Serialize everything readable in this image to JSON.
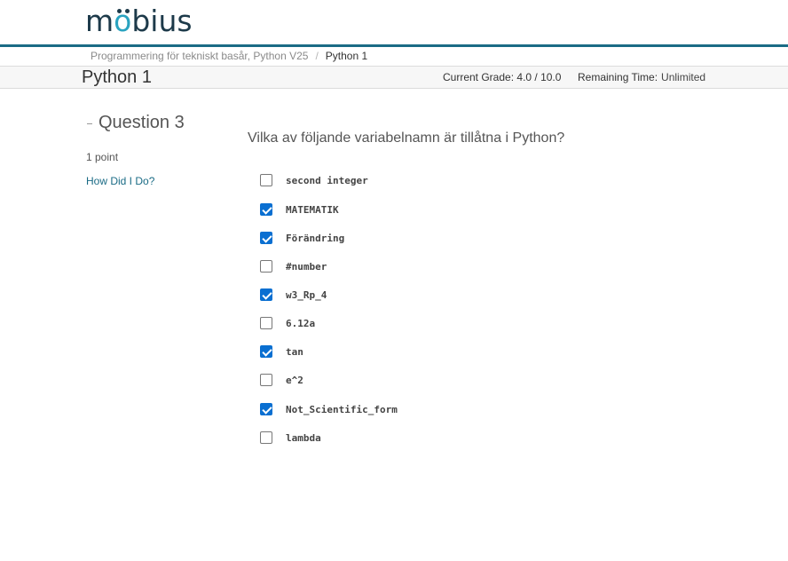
{
  "brand": {
    "logo_text": "möbius",
    "logo_prefix": "m",
    "logo_o": "o",
    "logo_suffix": "bius",
    "accent": "#2aa3c0",
    "bar_color": "#1a6b85"
  },
  "breadcrumb": {
    "course": "Programmering för tekniskt basår, Python V25",
    "separator": "/",
    "current": "Python 1"
  },
  "assignment": {
    "title": "Python 1",
    "grade_label": "Current Grade:",
    "grade_value": "4.0 / 10.0",
    "remaining_label": "Remaining Time:",
    "remaining_value": "Unlimited"
  },
  "question": {
    "heading": "Question 3",
    "points": "1 point",
    "how_did_i_do": "How Did I Do?",
    "prompt": "Vilka av följande variabelnamn är tillåtna i Python?",
    "options": [
      {
        "label": "second integer",
        "checked": false
      },
      {
        "label": "MATEMATIK",
        "checked": true
      },
      {
        "label": "Förändring",
        "checked": true
      },
      {
        "label": "#number",
        "checked": false
      },
      {
        "label": "w3_Rp_4",
        "checked": true
      },
      {
        "label": "6.12a",
        "checked": false
      },
      {
        "label": "tan",
        "checked": true
      },
      {
        "label": "e^2",
        "checked": false
      },
      {
        "label": "Not_Scientific_form",
        "checked": true
      },
      {
        "label": "lambda",
        "checked": false
      }
    ]
  }
}
